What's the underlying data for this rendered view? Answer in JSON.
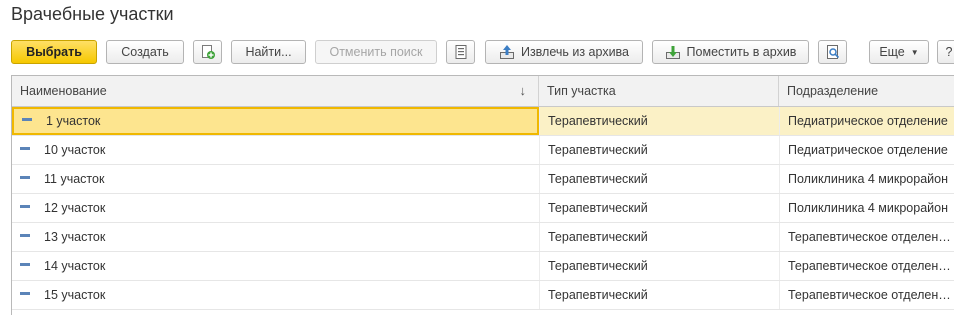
{
  "window": {
    "title": "Врачебные участки"
  },
  "toolbar": {
    "select_label": "Выбрать",
    "create_label": "Создать",
    "copy_icon": "add-copy-icon",
    "find_label": "Найти...",
    "cancel_search_label": "Отменить поиск",
    "list_icon": "list-icon",
    "extract_archive_label": "Извлечь из архива",
    "put_archive_label": "Поместить в архив",
    "search_doc_icon": "search-document-icon",
    "more_label": "Еще",
    "help_label": "?"
  },
  "table": {
    "columns": [
      {
        "label": "Наименование",
        "sort": "↓"
      },
      {
        "label": "Тип участка"
      },
      {
        "label": "Подразделение"
      }
    ],
    "rows": [
      {
        "name": "1 участок",
        "type": "Терапевтический",
        "dept": "Педиатрическое отделение",
        "selected": true
      },
      {
        "name": "10 участок",
        "type": "Терапевтический",
        "dept": "Педиатрическое отделение"
      },
      {
        "name": "11 участок",
        "type": "Терапевтический",
        "dept": "Поликлиника 4 микрорайон"
      },
      {
        "name": "12 участок",
        "type": "Терапевтический",
        "dept": "Поликлиника 4 микрорайон"
      },
      {
        "name": "13 участок",
        "type": "Терапевтический",
        "dept": "Терапевтическое отделение"
      },
      {
        "name": "14 участок",
        "type": "Терапевтический",
        "dept": "Терапевтическое отделение"
      },
      {
        "name": "15 участок",
        "type": "Терапевтический",
        "dept": "Терапевтическое отделение"
      }
    ]
  },
  "colors": {
    "primary_button": "#f6c800",
    "selected_row": "#fbf1c6",
    "selected_cell_border": "#f0b800",
    "row_icon": "#5b84b8"
  }
}
